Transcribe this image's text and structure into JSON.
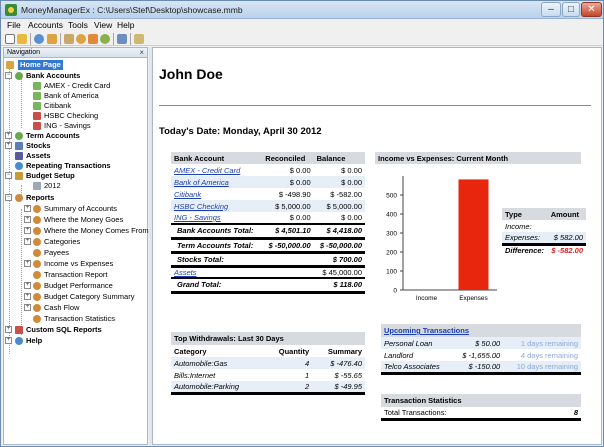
{
  "window": {
    "title": "MoneyManagerEx : C:\\Users\\Stef\\Desktop\\showcase.mmb",
    "min_glyph": "‒",
    "max_glyph": "□",
    "close_glyph": "✕"
  },
  "menu": [
    "File",
    "Accounts",
    "Tools",
    "View",
    "Help"
  ],
  "nav": {
    "title": "Navigation",
    "close_glyph": "×",
    "items": {
      "home": "Home Page",
      "bank_accounts": "Bank Accounts",
      "amex": "AMEX - Credit Card",
      "boa": "Bank of America",
      "citibank": "Citibank",
      "hsbc": "HSBC Checking",
      "ing": "ING - Savings",
      "term_accounts": "Term Accounts",
      "stocks": "Stocks",
      "assets": "Assets",
      "repeating": "Repeating Transactions",
      "budget_setup": "Budget Setup",
      "budget_2012": "2012",
      "reports": "Reports",
      "r_summary": "Summary of Accounts",
      "r_where_goes": "Where the Money Goes",
      "r_where_comes": "Where the Money Comes From",
      "r_categories": "Categories",
      "r_payees": "Payees",
      "r_income_exp": "Income vs Expenses",
      "r_transaction": "Transaction Report",
      "r_budget_perf": "Budget Performance",
      "r_budget_cat": "Budget Category Summary",
      "r_cashflow": "Cash Flow",
      "r_trans_stats": "Transaction Statistics",
      "custom_sql": "Custom SQL Reports",
      "help": "Help"
    }
  },
  "main": {
    "user_name": "John Doe",
    "today": "Today's Date: Monday, April 30 2012",
    "accounts": {
      "headers": [
        "Bank Account",
        "Reconciled",
        "Balance"
      ],
      "rows": [
        {
          "name": "AMEX - Credit Card",
          "reconciled": "$ 0.00",
          "balance": "$ 0.00"
        },
        {
          "name": "Bank of America",
          "reconciled": "$ 0.00",
          "balance": "$ 0.00"
        },
        {
          "name": "Citibank",
          "reconciled": "$ -498.90",
          "balance": "$ -582.00"
        },
        {
          "name": "HSBC Checking",
          "reconciled": "$ 5,000.00",
          "balance": "$ 5,000.00"
        },
        {
          "name": "ING - Savings",
          "reconciled": "$ 0.00",
          "balance": "$ 0.00"
        }
      ],
      "bank_total_label": "Bank Accounts Total:",
      "bank_total_reconciled": "$ 4,501.10",
      "bank_total_balance": "$ 4,418.00",
      "term_total_label": "Term Accounts Total:",
      "term_total_reconciled": "$ -50,000.00",
      "term_total_balance": "$ -50,000.00",
      "stocks_total_label": "Stocks Total:",
      "stocks_total": "$ 700.00",
      "assets_label": "Assets",
      "assets_total": "$ 45,000.00",
      "grand_total_label": "Grand Total:",
      "grand_total": "$ 118.00"
    },
    "withdrawals": {
      "title": "Top Withdrawals: Last 30 Days",
      "headers": [
        "Category",
        "Quantity",
        "Summary"
      ],
      "rows": [
        {
          "category": "Automobile:Gas",
          "quantity": "4",
          "summary": "$ -476.40"
        },
        {
          "category": "Bills:Internet",
          "quantity": "1",
          "summary": "$ -55.65"
        },
        {
          "category": "Automobile:Parking",
          "quantity": "2",
          "summary": "$ -49.95"
        }
      ]
    },
    "income_expenses": {
      "title": "Income vs Expenses: Current Month",
      "headers": [
        "Type",
        "Amount"
      ],
      "income_label": "Income:",
      "income_value": "",
      "expenses_label": "Expenses:",
      "expenses_value": "$ 582.00",
      "difference_label": "Difference:",
      "difference_value": "$ -582.00"
    },
    "upcoming": {
      "title": "Upcoming Transactions",
      "rows": [
        {
          "payee": "Personal Loan",
          "amount": "$ 50.00",
          "when": "1 days remaining"
        },
        {
          "payee": "Landlord",
          "amount": "$ -1,655.00",
          "when": "4 days remaining"
        },
        {
          "payee": "Telco Associates",
          "amount": "$ -150.00",
          "when": "10 days remaining"
        }
      ]
    },
    "stats": {
      "title": "Transaction Statistics",
      "label": "Total Transactions:",
      "value": "8"
    }
  },
  "chart_data": {
    "type": "bar",
    "categories": [
      "Income",
      "Expenses"
    ],
    "values": [
      0,
      582
    ],
    "ylim": [
      0,
      600
    ],
    "yticks": [
      "0",
      "100",
      "200",
      "300",
      "400",
      "500"
    ],
    "bar_color": "#e8260e",
    "grid": false
  }
}
